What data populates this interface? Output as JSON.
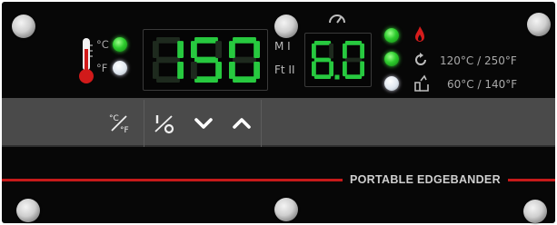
{
  "colors": {
    "panel_bg": "#070707",
    "band_bg": "#4a4a4a",
    "led_green": "#2ecc2e",
    "led_white": "#e8ecf1",
    "segment_on": "#27c93f",
    "segment_off": "#1e2a1e",
    "accent_red": "#c61a1a",
    "text_gray": "#b9b9b9"
  },
  "temperature_display": {
    "value": "150",
    "unit_c": "°C",
    "unit_f": "°F",
    "selected_unit": "C"
  },
  "mode_labels": {
    "top": "M I",
    "bottom": "Ft II"
  },
  "speed_display": {
    "value": "6.0"
  },
  "indicators": {
    "heat": {
      "state": "on",
      "icon": "flame-icon"
    },
    "cycle": {
      "state": "on",
      "icon": "cycle-icon",
      "label": "120°C / 250°F"
    },
    "standby": {
      "state": "off",
      "icon": "standby-icon",
      "label": "60°C / 140°F"
    }
  },
  "controls": {
    "unit_toggle": "°C/°F",
    "power": "I/O",
    "down": "chevron-down-icon",
    "up": "chevron-up-icon"
  },
  "brand": {
    "name": "PORTABLE EDGEBANDER"
  }
}
